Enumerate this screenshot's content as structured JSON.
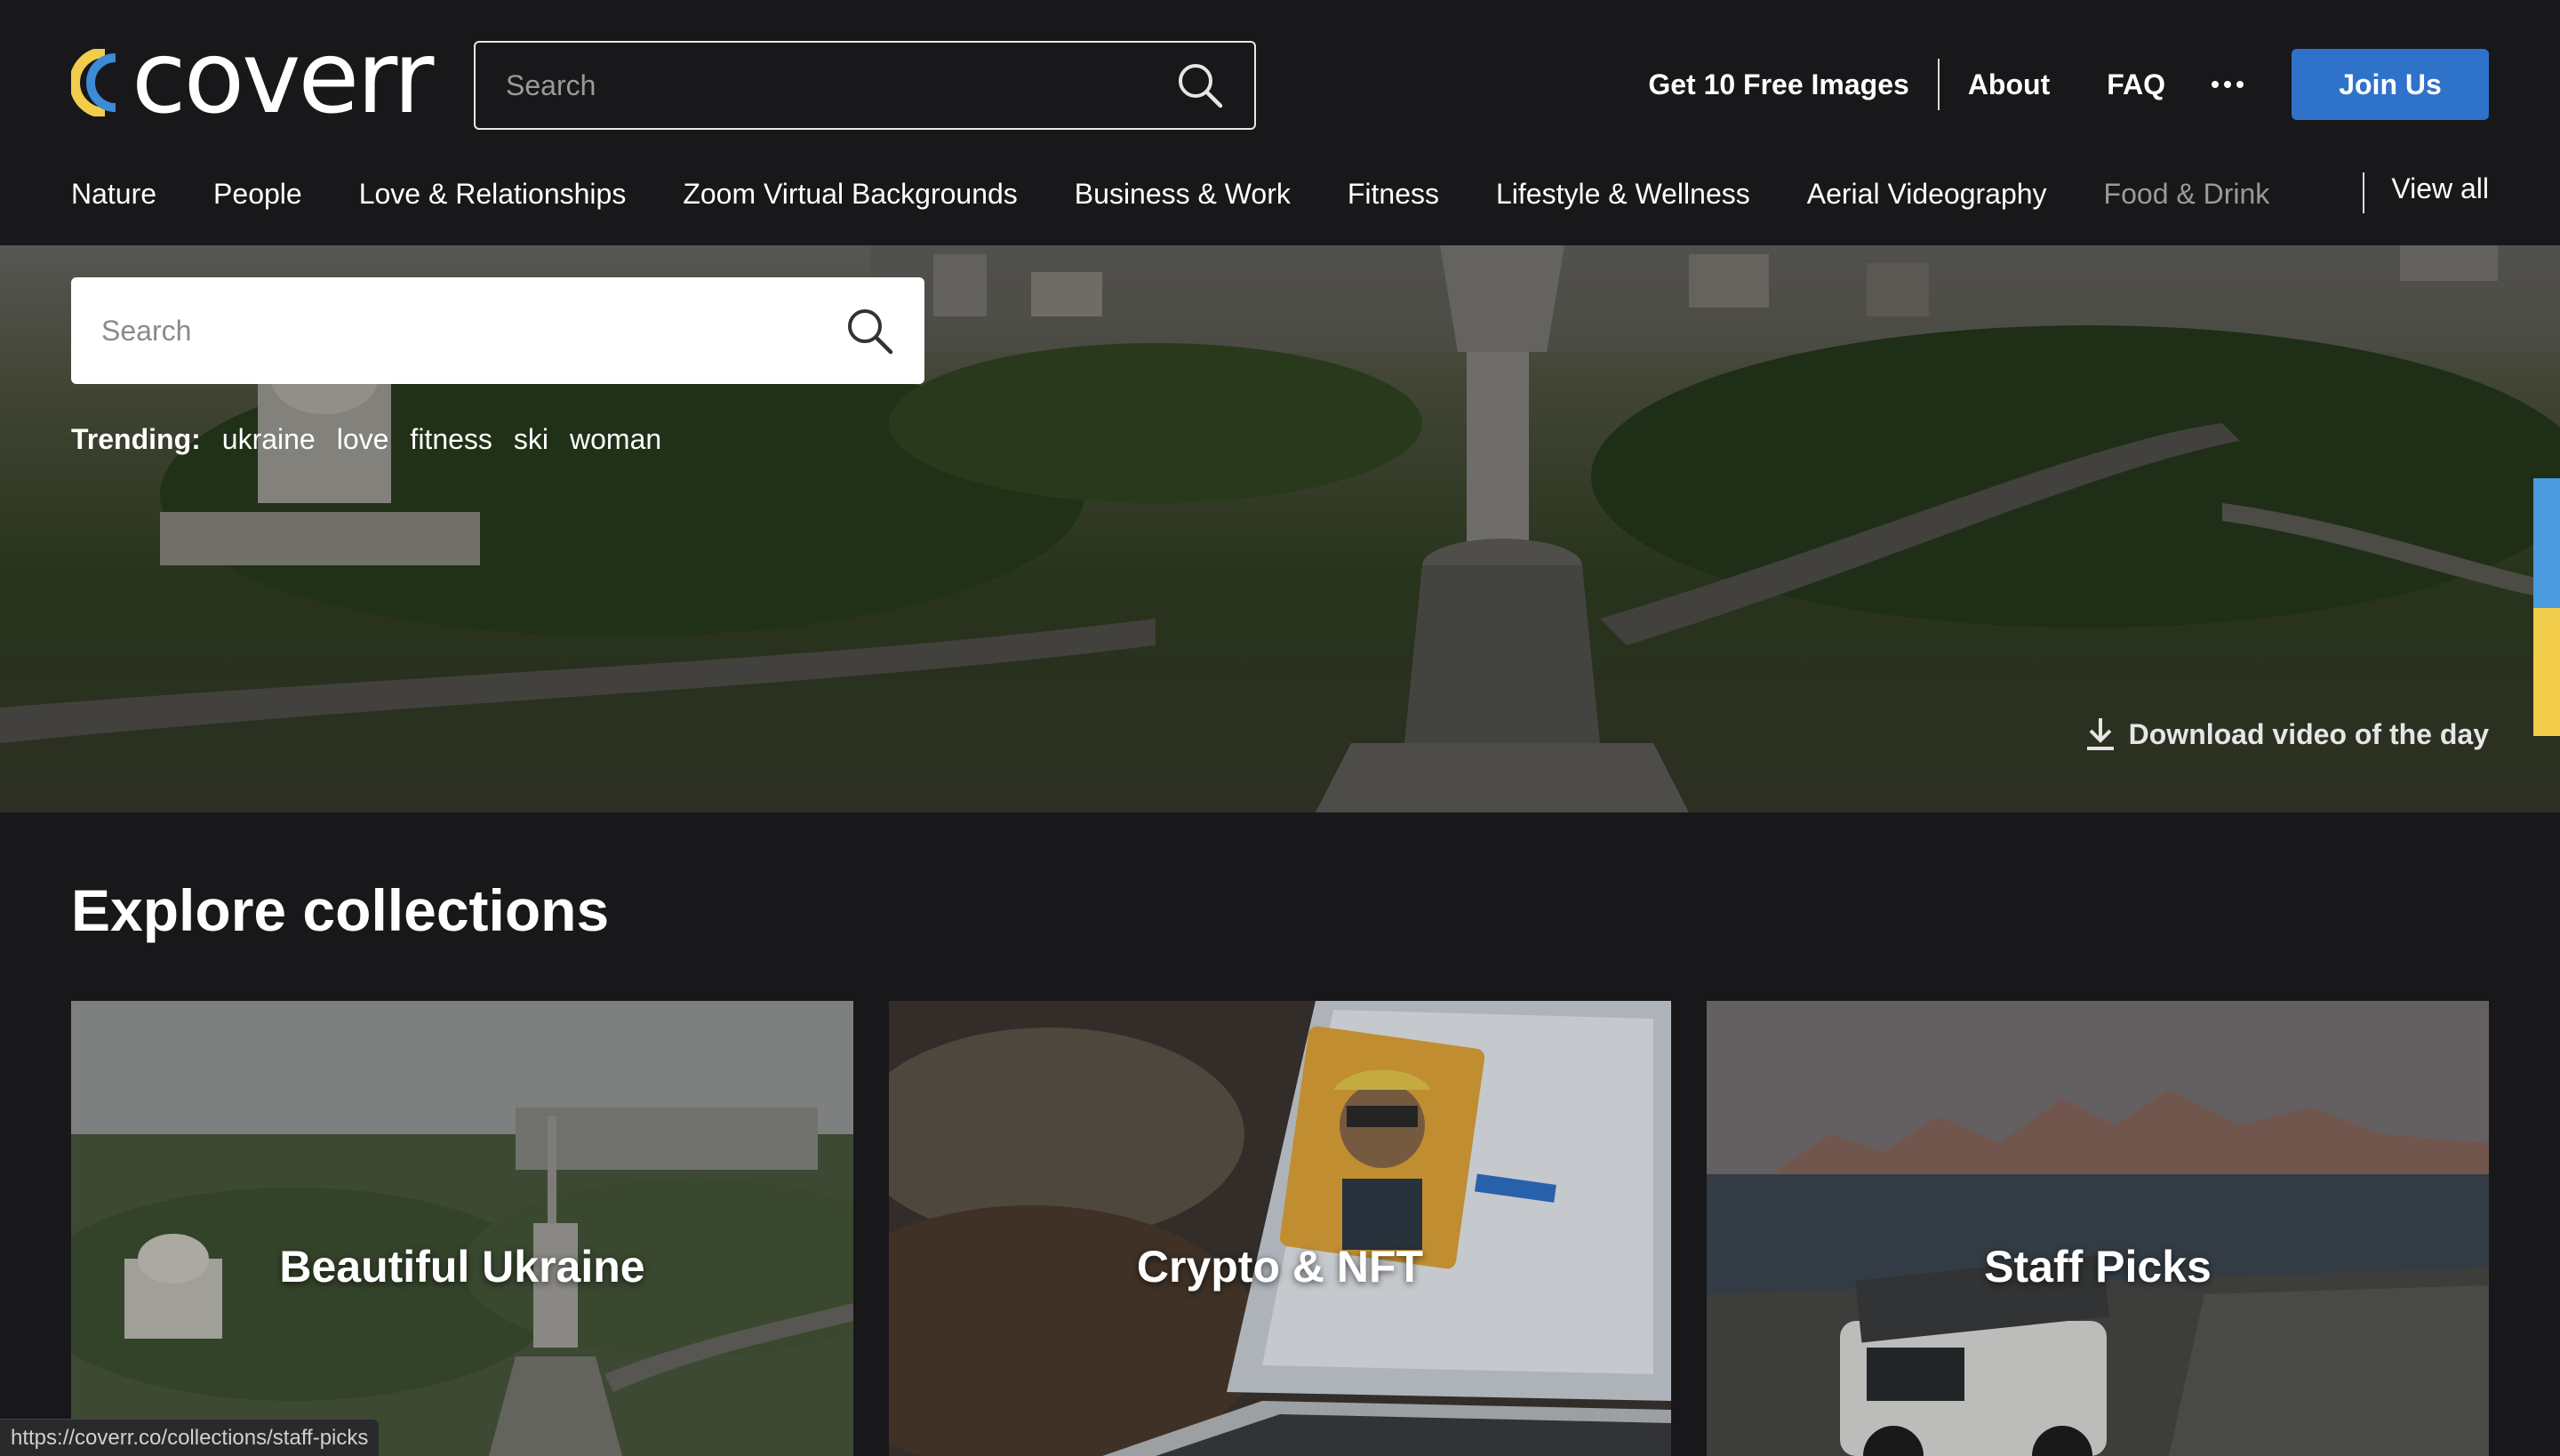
{
  "header": {
    "logo_text": "coverr",
    "search_placeholder": "Search",
    "links": {
      "free_images": "Get 10 Free Images",
      "about": "About",
      "faq": "FAQ"
    },
    "join_label": "Join Us"
  },
  "categories": [
    "Nature",
    "People",
    "Love & Relationships",
    "Zoom Virtual Backgrounds",
    "Business & Work",
    "Fitness",
    "Lifestyle & Wellness",
    "Aerial Videography",
    "Food & Drink"
  ],
  "view_all_label": "View all",
  "hero": {
    "search_placeholder": "Search",
    "trending_label": "Trending:",
    "trending_tags": [
      "ukraine",
      "love",
      "fitness",
      "ski",
      "woman"
    ],
    "download_label": "Download video of the day"
  },
  "collections": {
    "title": "Explore collections",
    "items": [
      {
        "title": "Beautiful Ukraine"
      },
      {
        "title": "Crypto & NFT"
      },
      {
        "title": "Staff Picks"
      }
    ]
  },
  "status_bar": {
    "url": "https://coverr.co/collections/staff-picks"
  },
  "colors": {
    "background": "#18181b",
    "accent": "#2f72c9",
    "side_tab_blue": "#4a9be0",
    "side_tab_yellow": "#f2cd4b"
  },
  "icons": [
    "search-icon",
    "more-dots-icon",
    "download-icon",
    "logo-mark"
  ]
}
